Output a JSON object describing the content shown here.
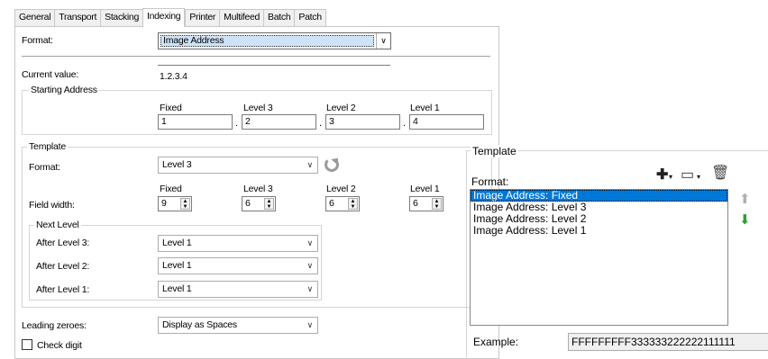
{
  "tabs": [
    "General",
    "Transport",
    "Stacking",
    "Indexing",
    "Printer",
    "Multifeed",
    "Batch",
    "Patch"
  ],
  "active_tab": "Indexing",
  "format": {
    "label": "Format:",
    "value": "Image Address"
  },
  "current_value": {
    "label": "Current value:",
    "value": "1.2.3.4"
  },
  "starting_address": {
    "title": "Starting Address",
    "columns": [
      "Fixed",
      "Level 3",
      "Level 2",
      "Level 1"
    ],
    "values": [
      "1",
      "2",
      "3",
      "4"
    ],
    "separator": "."
  },
  "template": {
    "title": "Template",
    "format_label": "Format:",
    "format_value": "Level 3",
    "field_width_label": "Field width:",
    "columns": [
      "Fixed",
      "Level 3",
      "Level 2",
      "Level 1"
    ],
    "widths": [
      "9",
      "6",
      "6",
      "6"
    ]
  },
  "next_level": {
    "title": "Next Level",
    "rows": [
      {
        "label": "After Level 3:",
        "value": "Level 1"
      },
      {
        "label": "After Level 2:",
        "value": "Level 1"
      },
      {
        "label": "After Level 1:",
        "value": "Level 1"
      }
    ]
  },
  "leading_zeroes": {
    "label": "Leading zeroes:",
    "value": "Display as Spaces"
  },
  "check_digit": {
    "label": "Check digit",
    "checked": false
  },
  "right_panel": {
    "title": "Template",
    "format_label": "Format:",
    "items": [
      "Image Address: Fixed",
      "Image Address: Level 3",
      "Image Address: Level 2",
      "Image Address: Level 1"
    ],
    "selected_index": 0,
    "example_label": "Example:",
    "example_value": "FFFFFFFFF333333222222111111"
  },
  "icons": {
    "add": "plus-icon",
    "field": "field-icon",
    "delete": "trash-icon",
    "up": "arrow-up-icon",
    "down": "arrow-down-icon",
    "refresh": "refresh-icon",
    "dropdown": "chevron-down-icon",
    "green": "#2e9e2e",
    "grey": "#b0b0b0"
  }
}
